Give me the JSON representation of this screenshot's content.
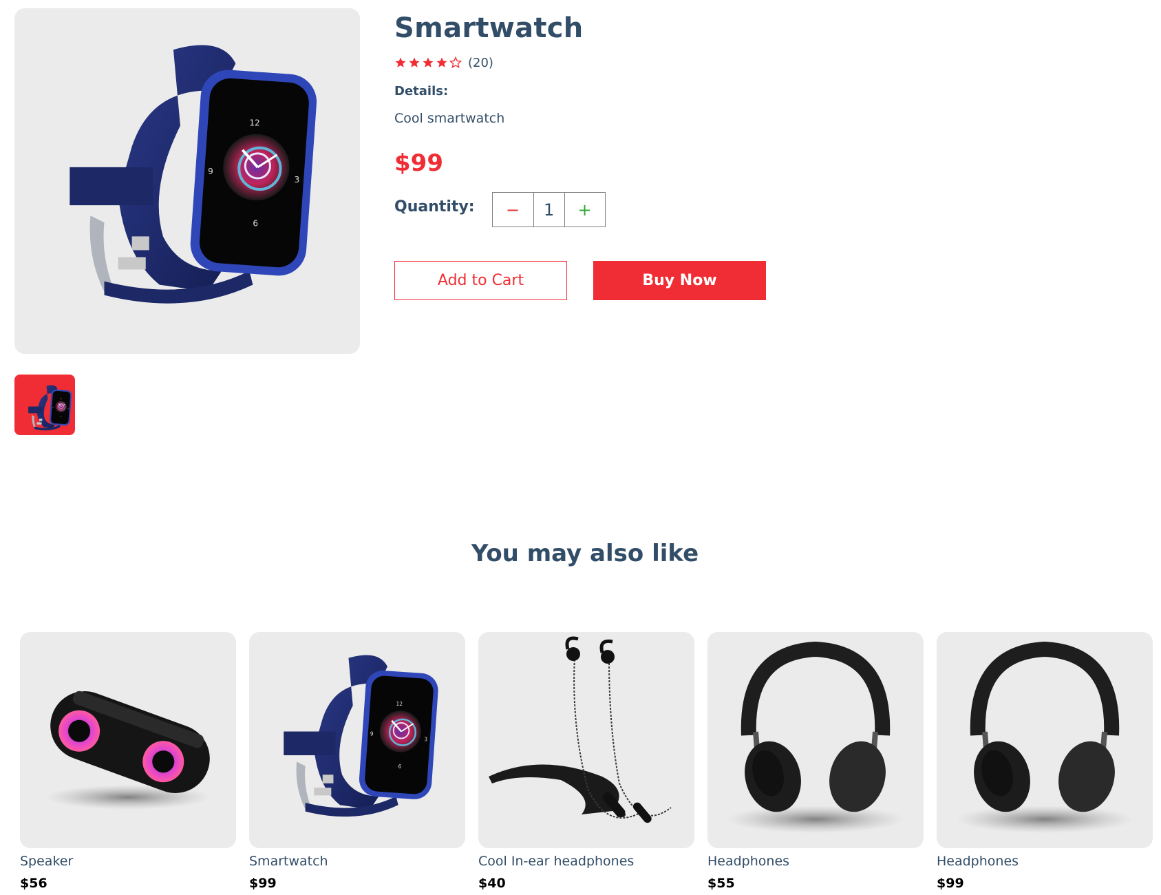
{
  "product": {
    "name": "Smartwatch",
    "rating": 4,
    "rating_max": 5,
    "review_count": "(20)",
    "details_label": "Details:",
    "description": "Cool smartwatch",
    "price": "$99",
    "quantity_label": "Quantity:",
    "quantity_minus": "−",
    "quantity_value": "1",
    "quantity_plus": "+",
    "add_to_cart_label": "Add to Cart",
    "buy_now_label": "Buy Now",
    "main_image_icon": "smartwatch-image",
    "thumbnail_icon": "smartwatch-thumbnail"
  },
  "recommendations": {
    "title": "You may also like",
    "items": [
      {
        "name": "Speaker",
        "price": "$56",
        "icon": "speaker-image"
      },
      {
        "name": "Smartwatch",
        "price": "$99",
        "icon": "smartwatch-image"
      },
      {
        "name": "Cool In-ear headphones",
        "price": "$40",
        "icon": "earphones-image"
      },
      {
        "name": "Headphones",
        "price": "$55",
        "icon": "headphones-image"
      },
      {
        "name": "Headphones",
        "price": "$99",
        "icon": "headphones-image"
      }
    ]
  },
  "colors": {
    "accent": "#f02d34",
    "heading": "#324d67",
    "card_bg": "#ebebeb",
    "plus": "#31a831"
  }
}
